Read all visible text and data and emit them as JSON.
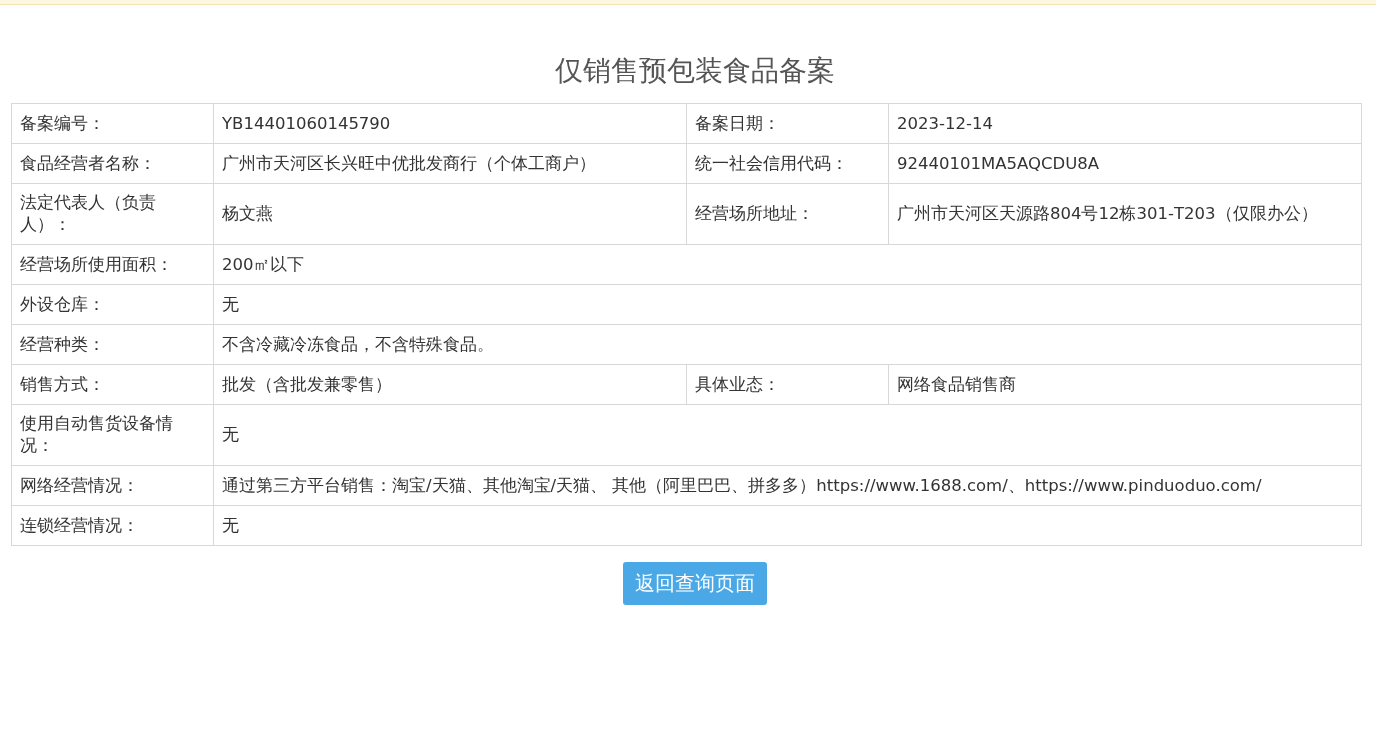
{
  "title": "仅销售预包装食品备案",
  "rows": [
    {
      "cells": [
        {
          "label": "备案编号：",
          "value": "YB14401060145790"
        },
        {
          "label": "备案日期：",
          "value": "2023-12-14"
        }
      ]
    },
    {
      "cells": [
        {
          "label": "食品经营者名称：",
          "value": "广州市天河区长兴旺中优批发商行（个体工商户）"
        },
        {
          "label": "统一社会信用代码：",
          "value": "92440101MA5AQCDU8A"
        }
      ]
    },
    {
      "cells": [
        {
          "label": "法定代表人（负责人）：",
          "value": "杨文燕"
        },
        {
          "label": "经营场所地址：",
          "value": "广州市天河区天源路804号12栋301-T203（仅限办公）"
        }
      ]
    },
    {
      "cells": [
        {
          "label": "经营场所使用面积：",
          "value": "200㎡以下"
        }
      ]
    },
    {
      "cells": [
        {
          "label": "外设仓库：",
          "value": "无"
        }
      ]
    },
    {
      "cells": [
        {
          "label": "经营种类：",
          "value": "不含冷藏冷冻食品，不含特殊食品。"
        }
      ]
    },
    {
      "cells": [
        {
          "label": "销售方式：",
          "value": "批发（含批发兼零售）"
        },
        {
          "label": "具体业态：",
          "value": "网络食品销售商"
        }
      ]
    },
    {
      "cells": [
        {
          "label": "使用自动售货设备情况：",
          "value": "无"
        }
      ]
    },
    {
      "cells": [
        {
          "label": "网络经营情况：",
          "value": "通过第三方平台销售：淘宝/天猫、其他淘宝/天猫、 其他（阿里巴巴、拼多多）https://www.1688.com/、https://www.pinduoduo.com/"
        }
      ]
    },
    {
      "cells": [
        {
          "label": "连锁经营情况：",
          "value": "无"
        }
      ]
    }
  ],
  "back_button": "返回查询页面"
}
